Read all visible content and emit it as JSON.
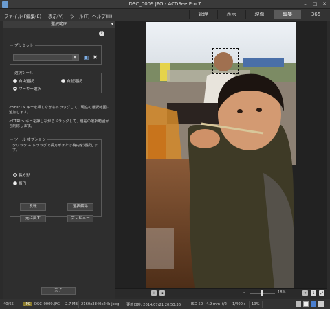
{
  "window": {
    "title": "DSC_0009.JPG - ACDSee Pro 7",
    "minimize": "–",
    "maximize": "□",
    "close": "✕"
  },
  "menu": [
    "ファイル(F)",
    "編集(E)",
    "表示(V)",
    "ツール(T)",
    "ヘルプ(H)"
  ],
  "modes": [
    {
      "label": "管理",
      "active": false
    },
    {
      "label": "表示",
      "active": false
    },
    {
      "label": "現像",
      "active": false
    },
    {
      "label": "編集",
      "active": true
    },
    {
      "label": "365",
      "active": false
    }
  ],
  "panel": {
    "title": "選択範囲",
    "caret": "▾",
    "help": "?",
    "preset": {
      "label": "プリセット",
      "value": "",
      "save_icon": "save-icon",
      "delete_icon": "delete-icon"
    },
    "tools": {
      "label": "選択ツール",
      "options": [
        "自由選択",
        "自動選択",
        "マーキー選択"
      ],
      "selected": "マーキー選択"
    },
    "hint_shift": "<SHIFT> キーを押しながらドラッグして、現在の選択範囲に追加します。",
    "hint_ctrl": "<CTRL> キーを押しながらドラッグして、現在の選択範囲から削除します。",
    "tool_options": {
      "label": "ツール オプション",
      "description": "クリック + ドラッグで長方形または楕円を選択します。",
      "shapes": [
        "長方形",
        "楕円"
      ],
      "selected": "長方形"
    },
    "buttons": {
      "invert": "反転",
      "clear": "選択解除",
      "restore": "元に戻す",
      "preview": "プレビュー",
      "done": "完了"
    }
  },
  "viewer": {
    "zoom_value": "18%",
    "zoom_level": 0.45
  },
  "status": {
    "position": "40/65",
    "format": "JPG",
    "filename": "DSC_0009.JPG",
    "size": "2.7 MB",
    "dimensions": "2160x3840x24b jpeg",
    "modified": "更新日時: 2014/07/21 20:53:36",
    "iso": "ISO 50",
    "focal": "4.9 mm",
    "aperture": "f/2",
    "shutter": "1/400 s",
    "zoom": "19%"
  },
  "colors": {
    "accent": "#7fb0e8",
    "panel_bg": "#2e2e2e",
    "active_tab": "#5a5a5a"
  }
}
